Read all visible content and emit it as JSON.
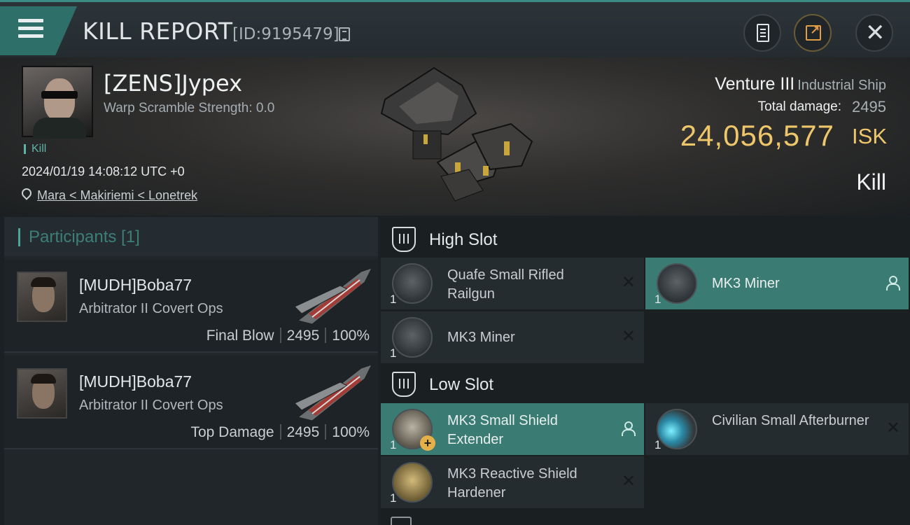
{
  "header": {
    "title": "KILL REPORT",
    "report_id": "[ID:9195479]",
    "buttons": [
      "clipboard-icon",
      "share-icon",
      "close-icon"
    ]
  },
  "victim": {
    "name": "[ZENS]Jypex",
    "warp_scramble": "Warp Scramble Strength: 0.0",
    "tag": "Kill",
    "datetime": "2024/01/19 14:08:12 UTC +0",
    "location": "Mara < Makiriemi < Lonetrek",
    "ship_name": "Venture III",
    "ship_class": "Industrial Ship",
    "total_damage_label": "Total damage:",
    "total_damage": "2495",
    "isk_value": "24,056,577",
    "isk_unit": "ISK",
    "result": "Kill"
  },
  "participants": {
    "title": "Participants [1]",
    "rows": [
      {
        "name": "[MUDH]Boba77",
        "ship": "Arbitrator II Covert Ops",
        "role": "Final Blow",
        "damage": "2495",
        "percent": "100%"
      },
      {
        "name": "[MUDH]Boba77",
        "ship": "Arbitrator II Covert Ops",
        "role": "Top Damage",
        "damage": "2495",
        "percent": "100%"
      }
    ]
  },
  "fitting": {
    "high_slot": {
      "label": "High Slot",
      "modules": [
        {
          "name": "Quafe Small Rifled Railgun",
          "qty": "1",
          "state": "destroyed"
        },
        {
          "name": "MK3 Miner",
          "qty": "1",
          "state": "dropped"
        },
        {
          "name": "MK3 Miner",
          "qty": "1",
          "state": "destroyed"
        }
      ]
    },
    "low_slot": {
      "label": "Low Slot",
      "modules": [
        {
          "name": "MK3 Small Shield Extender",
          "qty": "1",
          "state": "dropped"
        },
        {
          "name": "Civilian Small Afterburner",
          "qty": "1",
          "state": "destroyed"
        },
        {
          "name": "MK3 Reactive Shield Hardener",
          "qty": "1",
          "state": "destroyed"
        }
      ]
    }
  },
  "colors": {
    "accent_teal": "#3a7b73",
    "isk_gold": "#efc76b",
    "background": "#1b2024"
  }
}
